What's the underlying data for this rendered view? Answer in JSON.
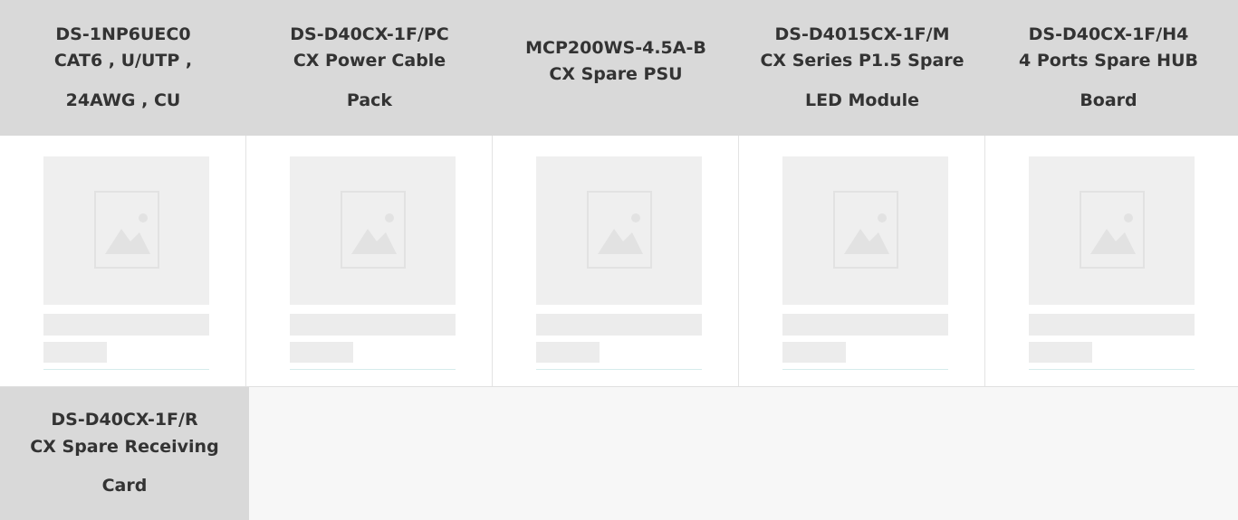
{
  "products": [
    {
      "lines": [
        "DS-1NP6UEC0",
        "CAT6 , U/UTP ,",
        "24AWG , CU"
      ]
    },
    {
      "lines": [
        "DS-D40CX-1F/PC",
        "CX Power Cable",
        "Pack"
      ]
    },
    {
      "lines": [
        "MCP200WS-4.5A-B",
        "CX Spare PSU"
      ]
    },
    {
      "lines": [
        "DS-D4015CX-1F/M",
        "CX Series P1.5 Spare",
        "LED Module"
      ]
    },
    {
      "lines": [
        "DS-D40CX-1F/H4",
        "4 Ports Spare HUB",
        "Board"
      ]
    }
  ],
  "bottom_product": {
    "lines": [
      "DS-D40CX-1F/R",
      "CX Spare Receiving",
      "Card"
    ]
  },
  "placeholder_icon": "image-placeholder-icon",
  "colors": {
    "header_bg": "#d9d9d9",
    "skeleton": "#efefef",
    "text": "#333333"
  }
}
